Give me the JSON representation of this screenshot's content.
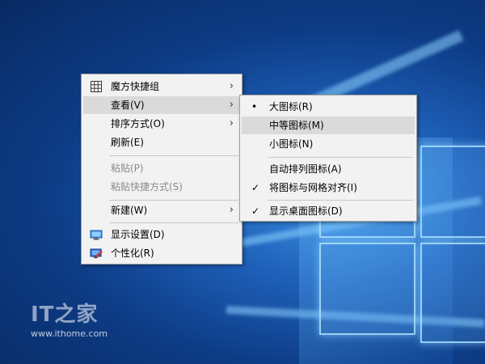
{
  "context_menu": {
    "items": [
      {
        "label": "魔方快捷组",
        "icon": "grid-icon",
        "has_submenu": true,
        "enabled": true
      },
      {
        "label": "查看(V)",
        "has_submenu": true,
        "enabled": true,
        "highlighted": true
      },
      {
        "label": "排序方式(O)",
        "has_submenu": true,
        "enabled": true
      },
      {
        "label": "刷新(E)",
        "has_submenu": false,
        "enabled": true
      },
      {
        "label": "粘贴(P)",
        "has_submenu": false,
        "enabled": false
      },
      {
        "label": "粘贴快捷方式(S)",
        "has_submenu": false,
        "enabled": false
      },
      {
        "label": "新建(W)",
        "has_submenu": true,
        "enabled": true
      },
      {
        "label": "显示设置(D)",
        "icon": "display-settings-icon",
        "enabled": true
      },
      {
        "label": "个性化(R)",
        "icon": "personalize-icon",
        "enabled": true
      }
    ],
    "submenu_arrow": "›"
  },
  "view_submenu": {
    "items": [
      {
        "label": "大图标(R)",
        "mark": "•",
        "selected": true
      },
      {
        "label": "中等图标(M)",
        "highlighted": true
      },
      {
        "label": "小图标(N)"
      },
      {
        "label": "自动排列图标(A)"
      },
      {
        "label": "将图标与网格对齐(I)",
        "mark": "✓",
        "checked": true
      },
      {
        "label": "显示桌面图标(D)",
        "mark": "✓",
        "checked": true
      }
    ]
  },
  "watermark": {
    "logo": "IT之家",
    "url": "www.ithome.com"
  },
  "colors": {
    "menu_bg": "#f2f2f2",
    "highlight": "#dadada",
    "disabled_text": "#8a8a8a",
    "desktop_blue": "#1e5fb8"
  }
}
